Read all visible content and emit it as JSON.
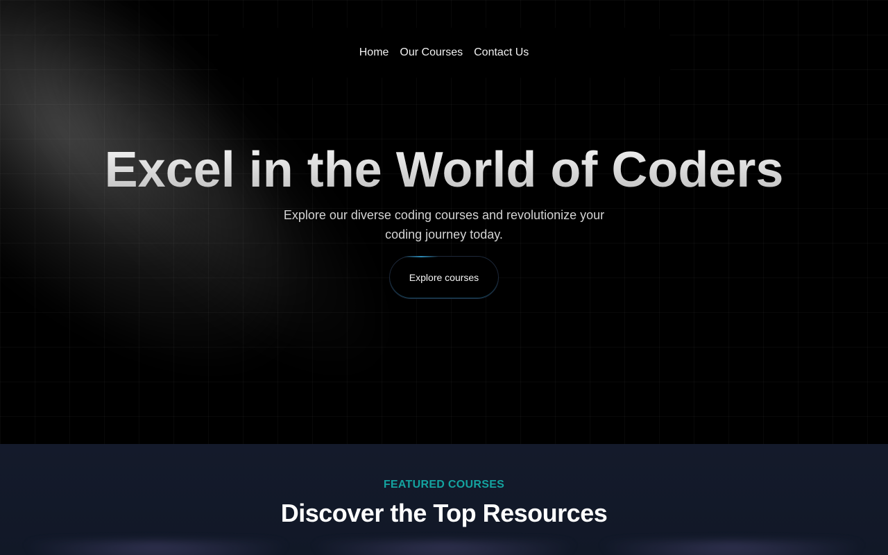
{
  "nav": {
    "items": [
      {
        "label": "Home"
      },
      {
        "label": "Our Courses"
      },
      {
        "label": "Contact Us"
      }
    ]
  },
  "hero": {
    "title": "Excel in the World of Coders",
    "subtitle": "Explore our diverse coding courses and revolutionize your coding journey today.",
    "cta_label": "Explore courses"
  },
  "featured": {
    "eyebrow": "FEATURED COURSES",
    "title": "Discover the Top Resources"
  },
  "colors": {
    "accent_teal": "#14a3a0",
    "hero_bg": "#000000",
    "section_bg": "#111827"
  }
}
